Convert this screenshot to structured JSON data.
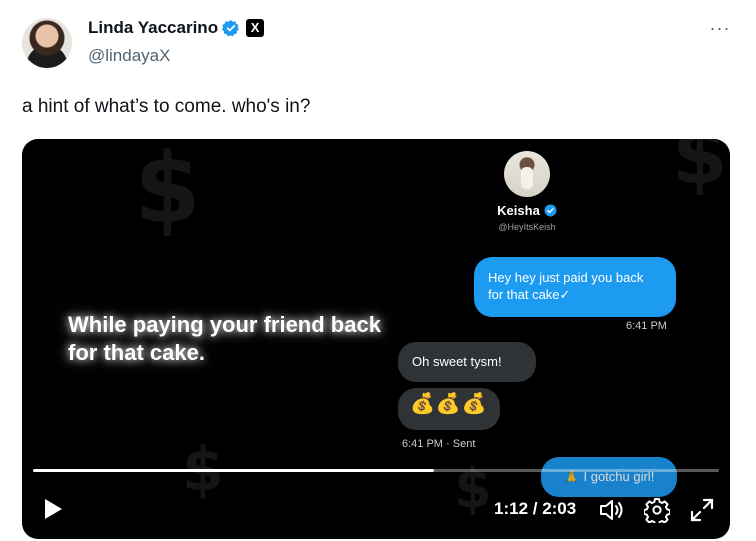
{
  "author": {
    "display_name": "Linda Yaccarino",
    "handle": "@lindayaX",
    "verified_icon": "verified-badge-icon",
    "affiliate_badge": "X",
    "more_label": "···"
  },
  "tweet": {
    "text": "a hint of what’s to come. who's in?"
  },
  "video": {
    "contact": {
      "name": "Keisha",
      "handle": "@HeyItsKeish"
    },
    "messages": {
      "sent_1": "Hey hey just paid you back for that cake✓",
      "sent_1_time": "6:41 PM",
      "recv_1": "Oh sweet tysm!",
      "recv_2": "💰💰💰",
      "recv_time": "6:41 PM · Sent",
      "sent_2": "🙏 I gotchu girl!"
    },
    "caption": "While paying your friend back for that cake.",
    "player": {
      "time": "1:12 / 2:03",
      "progress_fraction": 0.585
    }
  },
  "colors": {
    "accent": "#1d9bf0",
    "media_bg": "#000000",
    "received_bubble": "#2f3336"
  }
}
